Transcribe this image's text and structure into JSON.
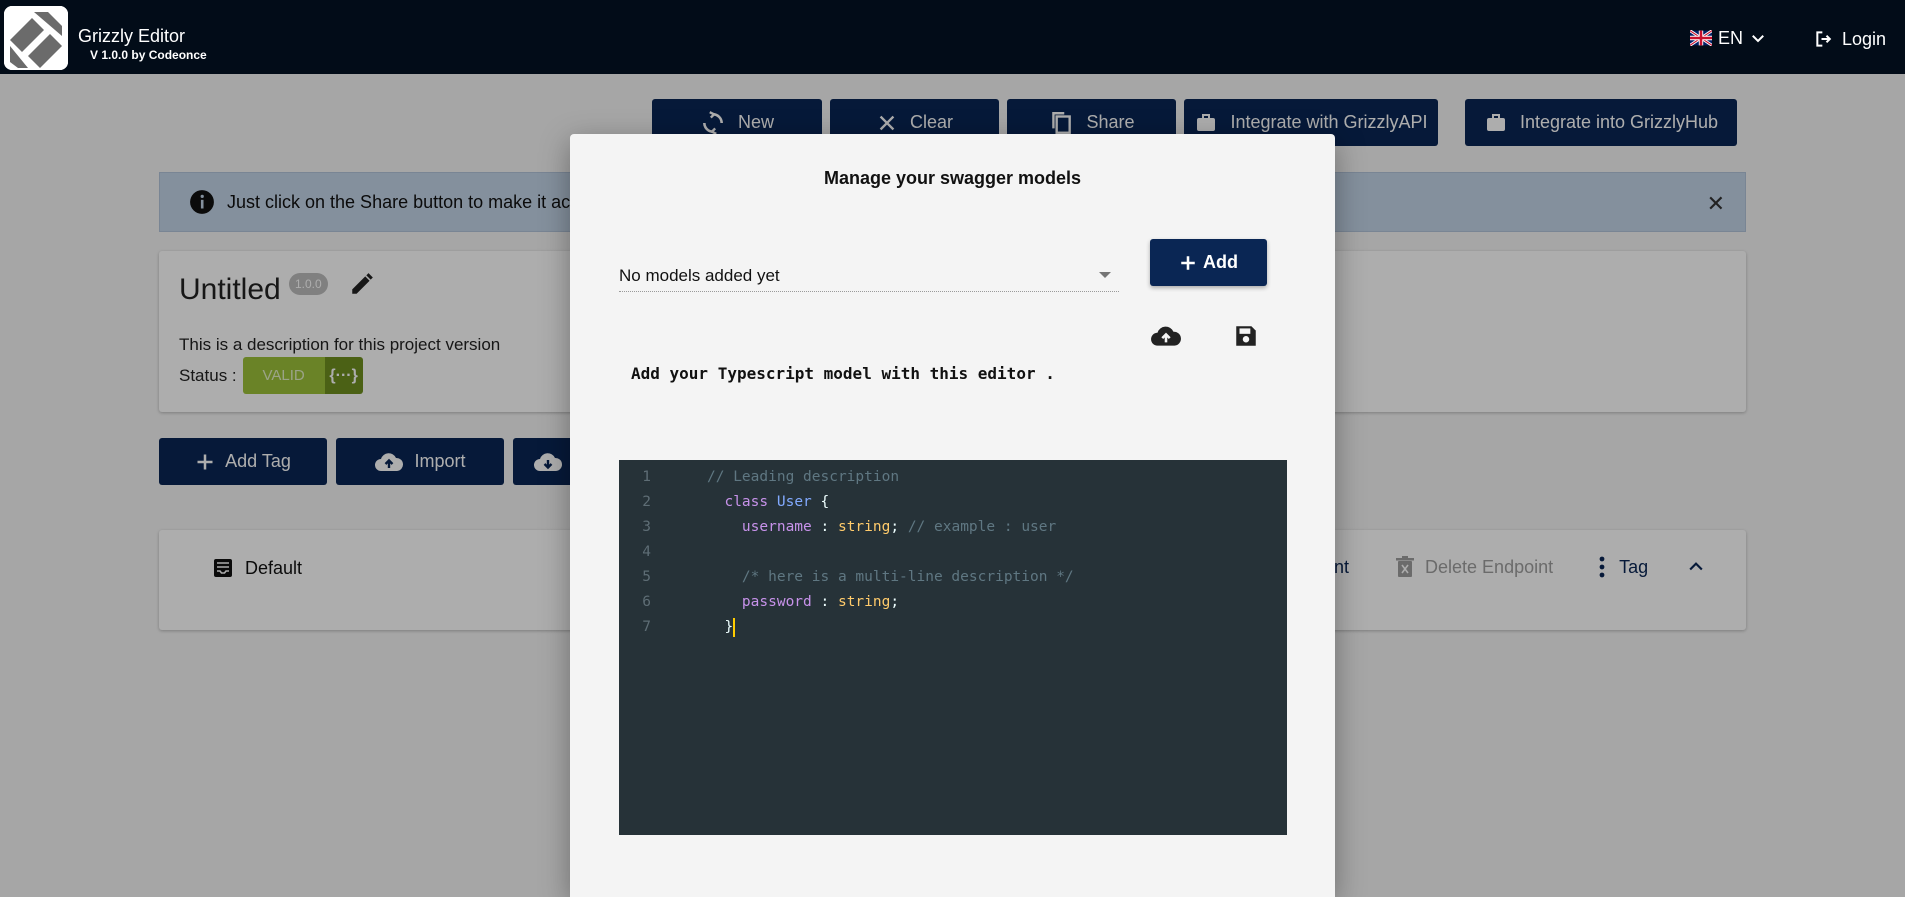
{
  "header": {
    "app_name": "Grizzly Editor",
    "version_label": "V 1.0.0 by Codeonce",
    "language": "EN",
    "login_label": "Login"
  },
  "toolbar": {
    "new_label": "New",
    "clear_label": "Clear",
    "share_label": "Share",
    "integrate_api_label": "Integrate with GrizzlyAPI",
    "integrate_hub_label": "Integrate into GrizzlyHub"
  },
  "alert": {
    "text": "Just click on the Share button to make it acc"
  },
  "project": {
    "title": "Untitled",
    "version": "1.0.0",
    "description": "This is a description for this project version",
    "status_label": "Status :",
    "status_value": "VALID",
    "status_json": "{···}"
  },
  "actions": {
    "add_tag_label": "Add Tag",
    "import_label": "Import"
  },
  "tag": {
    "name": "Default",
    "endpoint_fragment": "nt",
    "delete_endpoint_label": "Delete Endpoint",
    "tag_menu_label": "Tag"
  },
  "modal": {
    "title": "Manage your swagger models",
    "select_value": "No models added yet",
    "add_label": "Add",
    "editor_hint": "Add your Typescript model with this editor ."
  },
  "code_lines": [
    {
      "n": "1",
      "indent": "",
      "tokens": [
        {
          "t": "// Leading description",
          "c": "t-comment"
        }
      ]
    },
    {
      "n": "2",
      "indent": "  ",
      "tokens": [
        {
          "t": "class",
          "c": "t-kw"
        },
        {
          "t": " ",
          "c": "t-punc"
        },
        {
          "t": "User",
          "c": "t-cls"
        },
        {
          "t": " {",
          "c": "t-punc"
        }
      ]
    },
    {
      "n": "3",
      "indent": "    ",
      "tokens": [
        {
          "t": "username",
          "c": "t-prop"
        },
        {
          "t": " : ",
          "c": "t-punc"
        },
        {
          "t": "string",
          "c": "t-type"
        },
        {
          "t": "; ",
          "c": "t-punc"
        },
        {
          "t": "// example : user",
          "c": "t-comment"
        }
      ]
    },
    {
      "n": "4",
      "indent": "",
      "tokens": []
    },
    {
      "n": "5",
      "indent": "    ",
      "tokens": [
        {
          "t": "/* here is a multi-line description */",
          "c": "t-comment"
        }
      ]
    },
    {
      "n": "6",
      "indent": "    ",
      "tokens": [
        {
          "t": "password",
          "c": "t-prop"
        },
        {
          "t": " : ",
          "c": "t-punc"
        },
        {
          "t": "string",
          "c": "t-type"
        },
        {
          "t": ";",
          "c": "t-punc"
        }
      ]
    },
    {
      "n": "7",
      "indent": "  ",
      "tokens": [
        {
          "t": "}",
          "c": "t-punc"
        }
      ],
      "cursor": true
    }
  ],
  "colors": {
    "primary": "#0a2654",
    "topbar": "#020c18",
    "valid": "#9cc23a",
    "editor_bg": "#263238"
  }
}
